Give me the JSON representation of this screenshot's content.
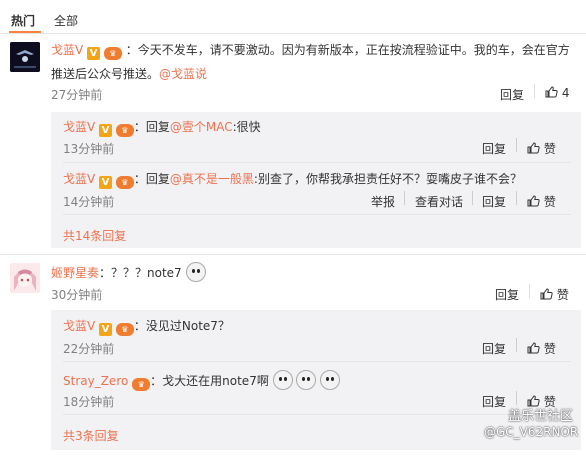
{
  "tabs": {
    "hot": "热门",
    "all": "全部"
  },
  "comments": [
    {
      "author": "戈蓝V",
      "text": "：今天不发车，请不要激动。因为有新版本，正在按流程验证中。我的车，会在官方",
      "text2": "推送后公众号推送。",
      "mention": "@戈蓝说",
      "time": "27分钟前",
      "reply": "回复",
      "likes": "4",
      "replies": [
        {
          "author": "戈蓝V",
          "prefix": "：回复",
          "mention": "@壹个MAC",
          "text": ":很快",
          "time": "13分钟前",
          "reply": "回复",
          "like": "赞"
        },
        {
          "author": "戈蓝V",
          "prefix": "：回复",
          "mention": "@真不是一般黑",
          "text": ":别查了，你帮我承担责任好不？耍嘴皮子谁不会？",
          "time": "14分钟前",
          "report": "举报",
          "view": "查看对话",
          "reply": "回复",
          "like": "赞"
        }
      ],
      "total": "共14条回复"
    },
    {
      "author": "姬野星奏",
      "text": "：？？？note7",
      "time": "30分钟前",
      "reply": "回复",
      "like": "赞",
      "replies": [
        {
          "author": "戈蓝V",
          "text": "：没见过Note7？",
          "time": "22分钟前",
          "reply": "回复",
          "like": "赞"
        },
        {
          "author": "Stray_Zero",
          "text": "：戈大还在用note7啊",
          "time": "18分钟前",
          "reply": "回复",
          "like": "赞"
        }
      ],
      "total": "共3条回复"
    }
  ],
  "badges": {
    "v": "V",
    "medal": "会员"
  },
  "watermark": {
    "line1": "盖乐世社区",
    "line2": "@GC_V62RNOR"
  },
  "colors": {
    "accent": "#eb7350",
    "reply_bg": "#f2f2f5",
    "tab_underline": "#ff8140"
  }
}
